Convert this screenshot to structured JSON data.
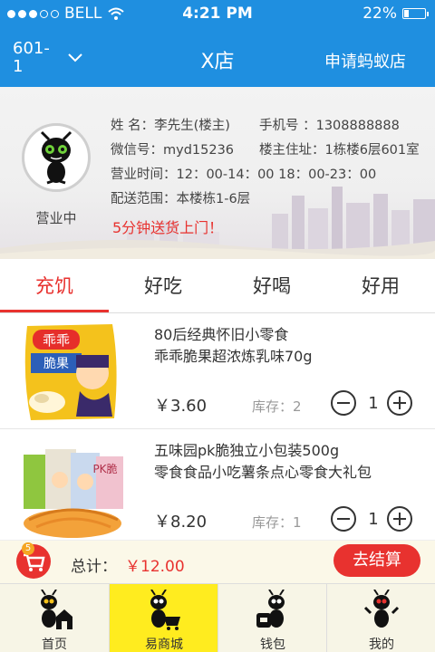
{
  "status_bar": {
    "carrier": "BELL",
    "time": "4:21 PM",
    "battery": "22%",
    "battery_level": 0.22,
    "icons": [
      "signal-dots",
      "wifi-icon",
      "battery-icon"
    ]
  },
  "nav": {
    "left_label": "601-1",
    "title": "X店",
    "right_link": "申请蚂蚁店",
    "chevron_icon": "chevron-down-icon"
  },
  "store": {
    "status": "营业中",
    "name_row": {
      "name": "姓  名：李先生(楼主)",
      "phone": "手机号  ：1308888888"
    },
    "wechat_row": {
      "wechat": "微信号：myd15236",
      "address": "楼主住址：1栋楼6层601室"
    },
    "hours": "营业时间：12：00-14：00  18：00-23：00",
    "delivery_range": "配送范围：本楼栋1-6层",
    "promo": "5分钟送货上门！"
  },
  "tabs": [
    {
      "label": "充饥",
      "active": true
    },
    {
      "label": "好吃",
      "active": false
    },
    {
      "label": "好喝",
      "active": false
    },
    {
      "label": "好用",
      "active": false
    }
  ],
  "products": [
    {
      "name_line1": "80后经典怀旧小零食",
      "name_line2": "乖乖脆果超浓炼乳味70g",
      "price": "￥3.60",
      "stock": "库存：2",
      "qty": "1",
      "image_text": "乖乖",
      "image_text2": "脆果"
    },
    {
      "name_line1": "五味园pk脆独立小包装500g",
      "name_line2": "零食食品小吃薯条点心零食大礼包",
      "price": "￥8.20",
      "stock": "库存：1",
      "qty": "1",
      "image_text": "PK脆"
    }
  ],
  "cart": {
    "badge": "5",
    "total_label": "总计：",
    "total_value": "￥12.00",
    "checkout_label": "去结算"
  },
  "bottom_nav": [
    {
      "label": "首页",
      "icon": "home-ant-icon",
      "active": false
    },
    {
      "label": "易商城",
      "icon": "shop-ant-icon",
      "active": true
    },
    {
      "label": "钱包",
      "icon": "wallet-ant-icon",
      "active": false
    },
    {
      "label": "我的",
      "icon": "profile-ant-icon",
      "active": false
    }
  ],
  "colors": {
    "primary_blue": "#1f8fe0",
    "accent_red": "#e8322f",
    "active_tab_yellow": "#ffec1f"
  }
}
